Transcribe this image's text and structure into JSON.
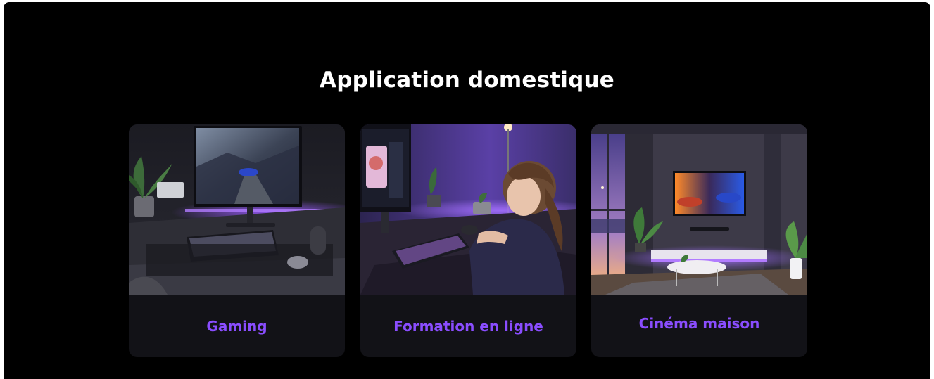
{
  "section": {
    "title": "Application domestique"
  },
  "colors": {
    "background": "#000000",
    "card_background": "#121217",
    "accent_label": "#8a4dff",
    "glow": "#8b4dff",
    "title": "#ffffff"
  },
  "cards": [
    {
      "label": "Gaming",
      "image": "gaming-desk-photo"
    },
    {
      "label": "Formation en ligne",
      "image": "online-learning-photo"
    },
    {
      "label": "Cinéma maison",
      "image": "home-cinema-photo"
    }
  ]
}
